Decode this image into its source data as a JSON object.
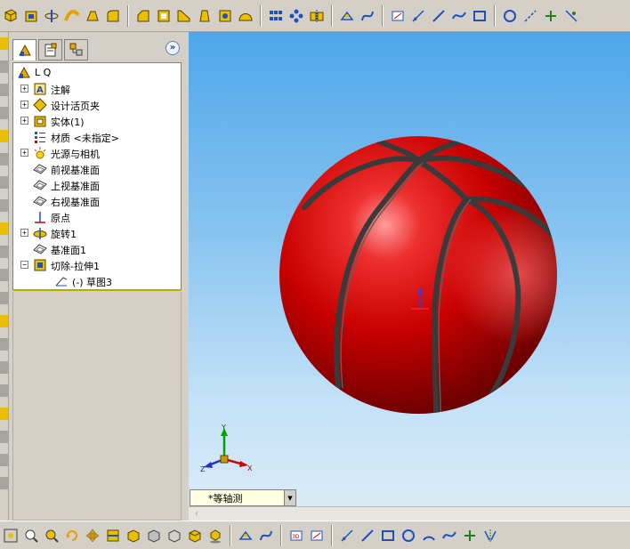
{
  "colors": {
    "chrome": "#d4d0c8",
    "tree_background": "#ffffff",
    "viewport_top": "#4ea6ea",
    "viewport_bottom": "#dcecf8",
    "ball_red": "#d40000",
    "ball_seam": "#3c3c3c",
    "tree_underline": "#b8a800"
  },
  "top_toolbar": {
    "buttons": [
      "extrude-boss-icon",
      "extrude-cut-icon",
      "revolve-icon",
      "sweep-icon",
      "loft-icon",
      "fillet-icon",
      "chamfer-icon",
      "shell-icon",
      "rib-icon",
      "draft-icon",
      "hole-icon",
      "dome-icon",
      "linear-pattern-icon",
      "circular-pattern-icon",
      "mirror-icon",
      "reference-geometry-icon",
      "curves-icon",
      "sketch-icon",
      "smart-dimension-icon",
      "line-icon",
      "spline-icon",
      "rectangle-icon",
      "circle-icon",
      "centerline-icon",
      "point-icon",
      "trim-icon"
    ]
  },
  "bottom_toolbar": {
    "buttons": [
      "zoom-fit-icon",
      "zoom-area-icon",
      "zoom-icon",
      "rotate-icon",
      "pan-icon",
      "section-view-icon",
      "standard-views-icon",
      "display-style-icon",
      "hidden-lines-icon",
      "shaded-icon",
      "shadows-icon",
      "reference-geometry-icon",
      "curves-icon",
      "3d-sketch-icon",
      "sketch-icon",
      "smart-dimension-icon",
      "line-icon",
      "rectangle-icon",
      "circle-icon",
      "arc-icon",
      "spline-icon",
      "point-icon",
      "mirror-entities-icon"
    ]
  },
  "feature_manager": {
    "tabs": [
      "feature-tree-tab",
      "property-manager-tab",
      "configuration-tab"
    ],
    "collapse_symbol": "»",
    "root_label": "L  Q",
    "items": [
      {
        "label": "注解",
        "icon": "annotations-icon",
        "expander": "+"
      },
      {
        "label": "设计活页夹",
        "icon": "design-binder-icon",
        "expander": "+"
      },
      {
        "label": "实体(1)",
        "icon": "solid-bodies-icon",
        "expander": "+"
      },
      {
        "label": "材质 <未指定>",
        "icon": "material-icon",
        "expander": ""
      },
      {
        "label": "光源与相机",
        "icon": "lights-cameras-icon",
        "expander": "+"
      },
      {
        "label": "前视基准面",
        "icon": "plane-icon",
        "expander": ""
      },
      {
        "label": "上视基准面",
        "icon": "plane-icon",
        "expander": ""
      },
      {
        "label": "右视基准面",
        "icon": "plane-icon",
        "expander": ""
      },
      {
        "label": "原点",
        "icon": "origin-icon",
        "expander": ""
      },
      {
        "label": "旋转1",
        "icon": "revolve-feature-icon",
        "expander": "+"
      },
      {
        "label": "基准面1",
        "icon": "plane-icon",
        "expander": ""
      },
      {
        "label": "切除-拉伸1",
        "icon": "cut-extrude-feature-icon",
        "expander": "−"
      },
      {
        "label": "(-) 草图3",
        "icon": "sketch-feature-icon",
        "expander": ""
      }
    ]
  },
  "viewport": {
    "view_orientation": "*等轴测",
    "triad_labels": {
      "x": "X",
      "y": "Y",
      "z": "Z"
    }
  }
}
